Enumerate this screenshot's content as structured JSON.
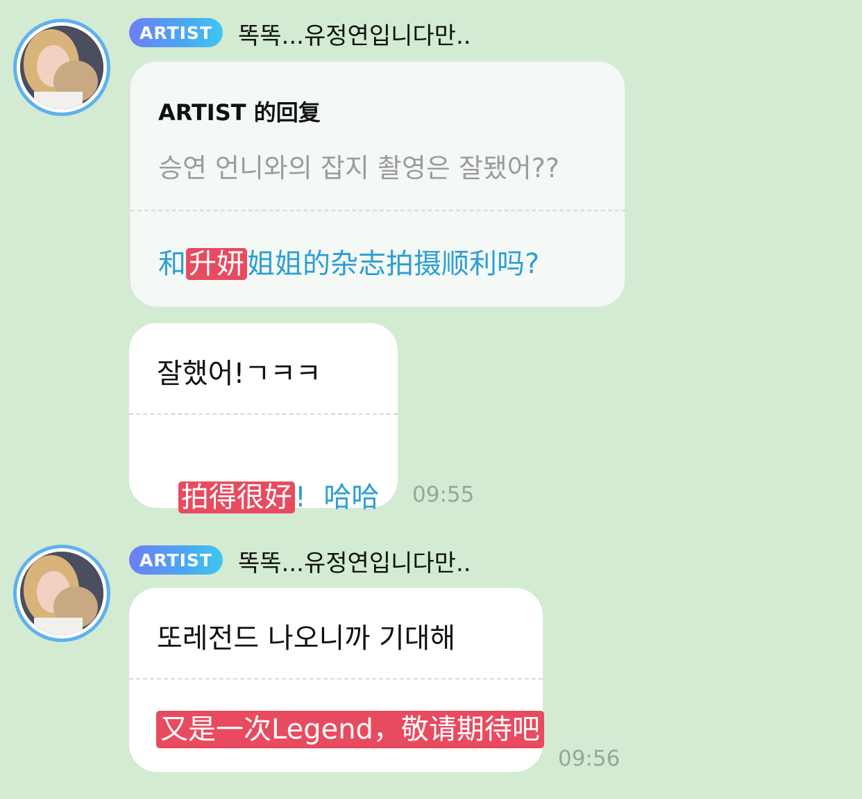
{
  "messages": [
    {
      "badge": "ARTIST",
      "author": "똑똑...유정연입니다만..",
      "reply": {
        "title": "ARTIST 的回复",
        "quoted_ko": "승연 언니와의 잡지 촬영은 잘됐어??",
        "quoted_zh_pre": "和",
        "quoted_zh_hl": "升妍",
        "quoted_zh_post": "姐姐的杂志拍摄顺利吗?"
      },
      "text_ko": "잘했어!ㄱㅋㅋ",
      "trans_hl": "拍得很好",
      "trans_rest": "!  哈哈",
      "time": "09:55"
    },
    {
      "badge": "ARTIST",
      "author": "똑똑...유정연입니다만..",
      "text_ko": "또레전드 나오니까 기대해",
      "trans_hl": "又是一次Legend，敬请期待吧",
      "time": "09:56"
    }
  ]
}
